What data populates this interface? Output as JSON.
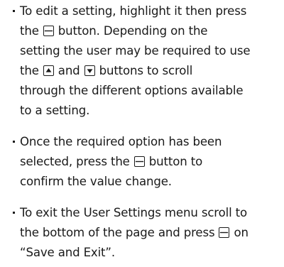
{
  "instructions": {
    "edit": {
      "line1": "To edit a setting, highlight it then press",
      "line2_before": "the",
      "line2_after": "button. Depending on the",
      "line3": "setting the user may be required to use",
      "line4_before": "the",
      "line4_middle": "and",
      "line4_after": "buttons to scroll",
      "line5": "through the different options available",
      "line6": "to a setting."
    },
    "confirm": {
      "line1": "Once the required option has been",
      "line2_before": "selected, press the",
      "line2_after": "button to",
      "line3": "confirm the value change."
    },
    "exit": {
      "line1": "To exit the User Settings menu scroll to",
      "line2_before": "the bottom of the page and press",
      "line2_after": "on",
      "line3": "“Save and Exit”."
    }
  },
  "icons": {
    "enter": "enter-button-icon",
    "up": "up-button-icon",
    "down": "down-button-icon"
  },
  "colors": {
    "text": "#1a1a1a",
    "background": "#ffffff"
  }
}
